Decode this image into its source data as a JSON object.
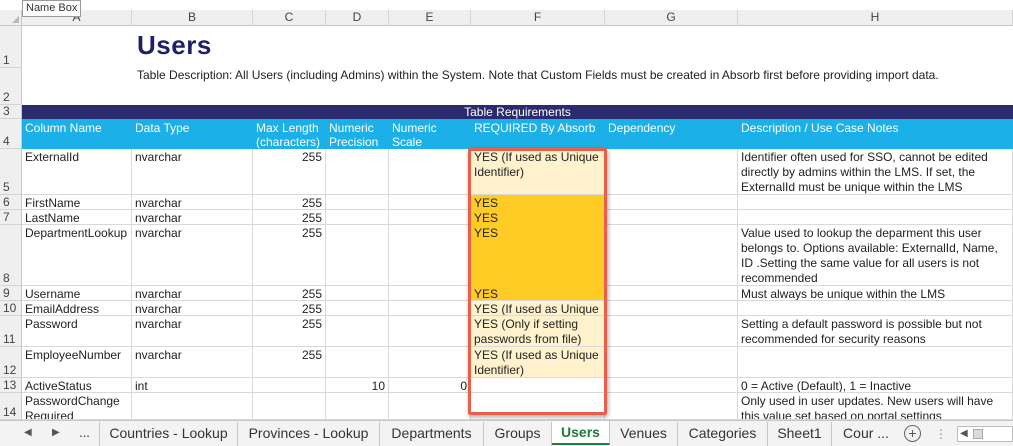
{
  "namebox": "Name Box",
  "columns": [
    "A",
    "B",
    "C",
    "D",
    "E",
    "F",
    "G",
    "H"
  ],
  "rows": [
    "1",
    "2",
    "3",
    "4",
    "5",
    "6",
    "7",
    "8",
    "9",
    "10",
    "11",
    "12",
    "13",
    "14"
  ],
  "title": "Users",
  "description": "Table Description: All Users (including Admins) within the System. Note that Custom Fields must be created in Absorb first before providing import data.",
  "requirements_band": "Table Requirements",
  "headers": {
    "column_name": "Column Name",
    "data_type": "Data Type",
    "max_length": "Max Length (characters)",
    "numeric_precision": "Numeric Precision",
    "numeric_scale": "Numeric Scale",
    "required": "REQUIRED By Absorb",
    "dependency": "Dependency",
    "description": "Description / Use Case Notes"
  },
  "data_rows": [
    {
      "name": "ExternalId",
      "type": "nvarchar",
      "max": "255",
      "prec": "",
      "scale": "",
      "req": "YES (If used as Unique Identifier)",
      "dep": "",
      "desc": "Identifier often used for SSO, cannot be edited directly by admins within the LMS. If set, the ExternalId must be unique within the LMS"
    },
    {
      "name": "FirstName",
      "type": "nvarchar",
      "max": "255",
      "prec": "",
      "scale": "",
      "req": "YES",
      "dep": "",
      "desc": ""
    },
    {
      "name": "LastName",
      "type": "nvarchar",
      "max": "255",
      "prec": "",
      "scale": "",
      "req": "YES",
      "dep": "",
      "desc": ""
    },
    {
      "name": "DepartmentLookup",
      "type": "nvarchar",
      "max": "255",
      "prec": "",
      "scale": "",
      "req": "YES",
      "dep": "",
      "desc": "Value used to lookup the deparment this user belongs to. Options available: ExternalId, Name, ID .Setting the same value for all users is not recommended"
    },
    {
      "name": "Username",
      "type": "nvarchar",
      "max": "255",
      "prec": "",
      "scale": "",
      "req": "YES",
      "dep": "",
      "desc": "Must always be unique within the LMS"
    },
    {
      "name": "EmailAddress",
      "type": "nvarchar",
      "max": "255",
      "prec": "",
      "scale": "",
      "req": "YES (If used as Unique",
      "dep": "",
      "desc": ""
    },
    {
      "name": "Password",
      "type": "nvarchar",
      "max": "255",
      "prec": "",
      "scale": "",
      "req": "YES (Only if setting passwords from file)",
      "dep": "",
      "desc": "Setting a default password is possible but not recommended for security reasons"
    },
    {
      "name": "EmployeeNumber",
      "type": "nvarchar",
      "max": "255",
      "prec": "",
      "scale": "",
      "req": "YES (If used as Unique Identifier)",
      "dep": "",
      "desc": ""
    },
    {
      "name": "ActiveStatus",
      "type": "int",
      "max": "",
      "prec": "10",
      "scale": "0",
      "req": "",
      "dep": "",
      "desc": "0 = Active (Default), 1 = Inactive"
    },
    {
      "name": "PasswordChange Required",
      "type": "",
      "max": "",
      "prec": "",
      "scale": "",
      "req": "",
      "dep": "",
      "desc": "Only used in user updates. New users will have this value set based on portal settings"
    }
  ],
  "tabs": {
    "more": "...",
    "items": [
      "Countries - Lookup",
      "Provinces - Lookup",
      "Departments",
      "Groups",
      "Users",
      "Venues",
      "Categories",
      "Sheet1",
      "Cour ..."
    ],
    "active": "Users",
    "add": "+"
  },
  "colors": {
    "title": "#1f1f6b",
    "band": "#2a2a6e",
    "header": "#1bb1e8",
    "yes_gold": "#ffcc26",
    "yes_pale": "#fff2cc",
    "highlight": "#e8604a"
  }
}
